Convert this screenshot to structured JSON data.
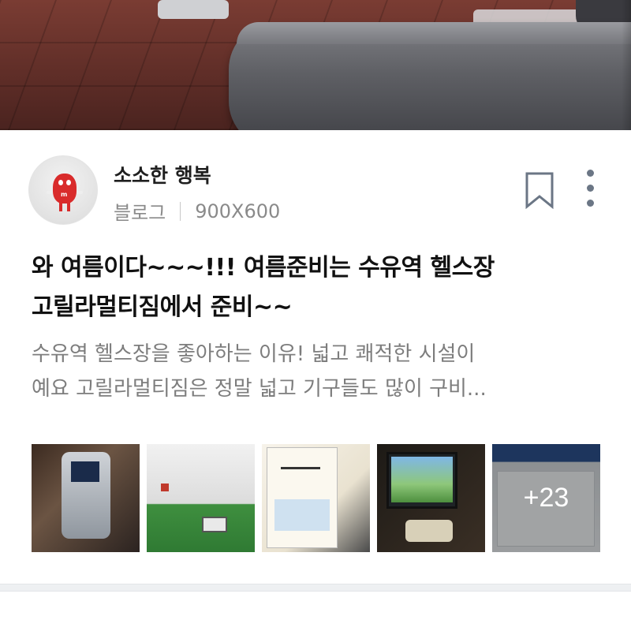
{
  "post": {
    "author_name": "소소한 행복",
    "source_label": "블로그",
    "image_size": "900X600",
    "title_line1": "와 여름이다~~~!!! 여름준비는 수유역 헬스장",
    "title_line2": "고릴라멀티짐에서 준비~~",
    "summary_line1": "수유역 헬스장을 좋아하는 이유! 넓고 쾌적한 시설이",
    "summary_line2": "예요 고릴라멀티짐은 정말 넓고 기구들도 많이 구비...",
    "more_images_label": "+23"
  },
  "icons": {
    "bookmark": "bookmark-icon",
    "more": "more-vertical-icon"
  },
  "colors": {
    "accent_gray": "#6b7685",
    "meta_text": "#8a8a8a",
    "summary_text": "#7d7d7d"
  }
}
